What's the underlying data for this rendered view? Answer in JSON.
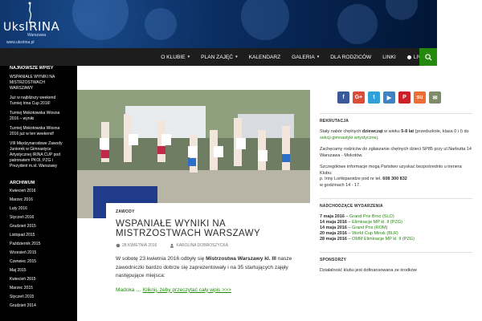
{
  "header": {
    "logo_prefix": "Uks",
    "logo_name": "IRINA",
    "logo_sub": "Warszawa",
    "logo_url": "www.uksirina.pl",
    "colors": {
      "header_bg": "#0b2f63",
      "nav_bg": "#1d1d1d",
      "accent": "#24890d"
    }
  },
  "nav": {
    "items": [
      {
        "label": "O KLUBIE",
        "caret": "▾"
      },
      {
        "label": "PLAN ZAJĘĆ",
        "caret": "▾"
      },
      {
        "label": "KALENDARZ",
        "caret": ""
      },
      {
        "label": "GALERIA",
        "caret": "▾"
      },
      {
        "label": "DLA RODZICÓW",
        "caret": ""
      },
      {
        "label": "LINKI",
        "caret": ""
      },
      {
        "label": "LIVE",
        "caret": ""
      }
    ],
    "search_icon": "search-icon"
  },
  "left_sidebar": {
    "recent_heading": "NAJNOWSZE WPISY",
    "recent": [
      "WSPANIAŁE WYNIKI NA MISTRZOSTWACH WARSZAWY",
      "Już w najbliższy weekend Turniej Irina Cup 2016!",
      "Turniej Mokotowska Wiosna 2016 – wyniki",
      "Turniej Mokotowska Wiosna 2016 już w ten weekend!",
      "VIII Międzynarodowe Zawody Juniorek w Gimnastyce Artystycznej IRINA CUP pod patronatem PKOl, PZG i Prezydent m.st. Warszawy"
    ],
    "archive_heading": "ARCHIWUM",
    "archive": [
      "Kwiecień 2016",
      "Marzec 2016",
      "Luty 2016",
      "Styczeń 2016",
      "Grudzień 2015",
      "Listopad 2015",
      "Październik 2015",
      "Wrzesień 2015",
      "Czerwiec 2015",
      "Maj 2015",
      "Kwiecień 2015",
      "Marzec 2015",
      "Styczeń 2015",
      "Grudzień 2014"
    ]
  },
  "post": {
    "category": "ZAWODY",
    "title": "WSPANIAŁE WYNIKI NA MISTRZOSTWACH WARSZAWY",
    "date": "28 KWIETNIA 2016",
    "author": "KAROLINA DOBROSZYCKA",
    "content_before": "W sobotę 23 kwietnia 2016 odbyły się ",
    "content_bold": "Mistrzostwa Warszawy kl. III",
    "content_after": " nasze zawodniczki bardzo dobrze się zaprezentowały i na 35 startujących zajęły następujące miejsca:",
    "more_prefix": "Madoka … ",
    "more_link": "Kliknij, żeby przeczytać cały wpis >>>"
  },
  "right_sidebar": {
    "social": [
      {
        "icon": "facebook-icon",
        "glyph": "f",
        "color": "#3b5998"
      },
      {
        "icon": "google-plus-icon",
        "glyph": "G+",
        "color": "#dd4b39"
      },
      {
        "icon": "twitter-icon",
        "glyph": "t",
        "color": "#2fa0d8"
      },
      {
        "icon": "youtube-icon",
        "glyph": "▶",
        "color": "#3e84c4"
      },
      {
        "icon": "pinterest-icon",
        "glyph": "P",
        "color": "#cb2027"
      },
      {
        "icon": "stumbleupon-icon",
        "glyph": "su",
        "color": "#eb6f34"
      },
      {
        "icon": "email-icon",
        "glyph": "✉",
        "color": "#7d8b6b"
      }
    ],
    "recruit_heading": "REKRUTACJA",
    "recruit_p1a": "Stały nabór chętnych ",
    "recruit_p1b": "dziewcząt",
    "recruit_p1c": " w wieku ",
    "recruit_p1d": "5-8 lat",
    "recruit_p1e": " (przedszkole, klasa 0 i I) do ",
    "recruit_p1f": "sekcji gimnastyki artystycznej",
    "recruit_p2": "Zachęcamy rodziców do zgłaszanie chętnych dzieci SP85 przy ul.Narbutta 14 Warszawa - Mokotów.",
    "recruit_p3a": "Szczegółowe informacje mogą Państwo uzyskać bezpośrednio u trenera Klubu:",
    "recruit_p3b": "p. Iriny Lortkipanidze pod nr tel. ",
    "recruit_phone": "608 300 832",
    "recruit_p3c": "w godzinach 14 - 17.",
    "events_heading": "NADCHODZĄCE WYDARZENIA",
    "events": [
      {
        "date": "7 maja 2016",
        "name": "Grand Prix Brno (SLO)"
      },
      {
        "date": "14 maja 2016",
        "name": "Eliminacje MP kl. II (PZG)"
      },
      {
        "date": "14 maja 2016",
        "name": "Grand Prix (ROM)"
      },
      {
        "date": "20 maja 2016",
        "name": "World Cup Minsk (BLR)"
      },
      {
        "date": "28 maja 2016",
        "name": "OMM Eliminacje MP kl. II (PZG)"
      }
    ],
    "sponsors_heading": "SPONSORZY",
    "sponsors_text": "Działalność klubu jest dofinansowana ze środków"
  }
}
